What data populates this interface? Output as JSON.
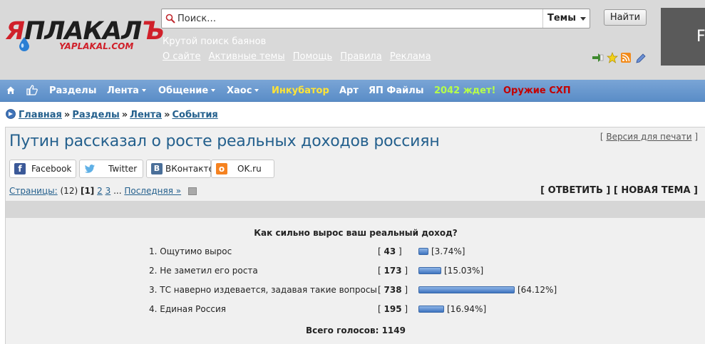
{
  "header": {
    "logo_text_red": "Я",
    "logo_text_dark": "ПЛАКАЛ",
    "logo_text_end": "Ъ",
    "logo_sub": "YAPLAKAL.COM",
    "search_placeholder": "Поиск…",
    "search_scope": "Темы",
    "find_button": "Найти",
    "right_block_letter": "F",
    "tagline": "Крутой поиск баянов",
    "links": [
      "О сайте",
      "Активные темы",
      "Помощь",
      "Правила",
      "Реклама"
    ]
  },
  "nav": {
    "items": [
      {
        "label": "Разделы",
        "dropdown": false
      },
      {
        "label": "Лента",
        "dropdown": true
      },
      {
        "label": "Общение",
        "dropdown": true
      },
      {
        "label": "Хаос",
        "dropdown": true
      },
      {
        "label": "Инкубатор",
        "dropdown": false
      },
      {
        "label": "Арт",
        "dropdown": false
      },
      {
        "label": "ЯП Файлы",
        "dropdown": false
      },
      {
        "label": "2042 ждет!",
        "dropdown": false
      },
      {
        "label": "Оружие СХП",
        "dropdown": false
      }
    ]
  },
  "breadcrumb": [
    "Главная",
    "Разделы",
    "Лента",
    "События"
  ],
  "topic": {
    "title": "Путин рассказал о росте реальных доходов россиян",
    "print_version": "Версия для печати",
    "share": [
      "Facebook",
      "Twitter",
      "ВКонтакте",
      "OK.ru"
    ],
    "pages_label": "Страницы:",
    "pages_total": "(12)",
    "page_current": "[1]",
    "page_2": "2",
    "page_3": "3",
    "page_ellipsis": "...",
    "page_last": "Последняя »",
    "reply": "[ ОТВЕТИТЬ ]",
    "new_topic": "[ НОВАЯ ТЕМА ]"
  },
  "poll": {
    "question": "Как сильно вырос ваш реальный доход?",
    "options": [
      {
        "label": "1. Ощутимо вырос",
        "votes": "43",
        "percent": "[3.74%]",
        "fraction": 0.0374
      },
      {
        "label": "2. Не заметил его роста",
        "votes": "173",
        "percent": "[15.03%]",
        "fraction": 0.1503
      },
      {
        "label": "3. ТС наверно издевается, задавая такие вопросы",
        "votes": "738",
        "percent": "[64.12%]",
        "fraction": 0.6412
      },
      {
        "label": "4. Единая Россия",
        "votes": "195",
        "percent": "[16.94%]",
        "fraction": 0.1694
      }
    ],
    "total": "Всего голосов: 1149"
  },
  "colors": {
    "brand_red": "#d0202a",
    "link_blue": "#24608d",
    "nav_blue": "#5a8dc7"
  }
}
